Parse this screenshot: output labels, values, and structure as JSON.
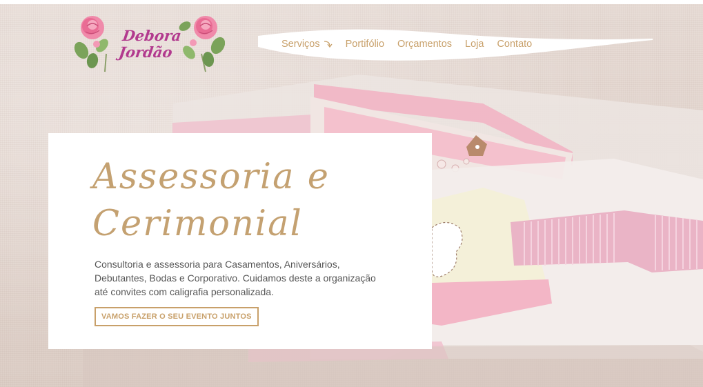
{
  "brand": {
    "name_line1": "Debora",
    "name_line2": "Jordão"
  },
  "nav": {
    "items": [
      {
        "label": "Serviços",
        "has_dropdown": true
      },
      {
        "label": "Portifólio"
      },
      {
        "label": "Orçamentos"
      },
      {
        "label": "Loja"
      },
      {
        "label": "Contato"
      }
    ]
  },
  "hero": {
    "title_line1": "Assessoria e",
    "title_line2": "Cerimonial",
    "description": "Consultoria e assessoria para Casamentos, Aniversários, Debutantes, Bodas e Corporativo. Cuidamos deste a organização até convites com caligrafia personalizada.",
    "cta_label": "VAMOS FAZER O SEU EVENTO JUNTOS"
  },
  "colors": {
    "accent_gold": "#c8a06a",
    "brand_magenta": "#b23a8e",
    "text_gray": "#555555",
    "rose_pink": "#e8739a"
  }
}
